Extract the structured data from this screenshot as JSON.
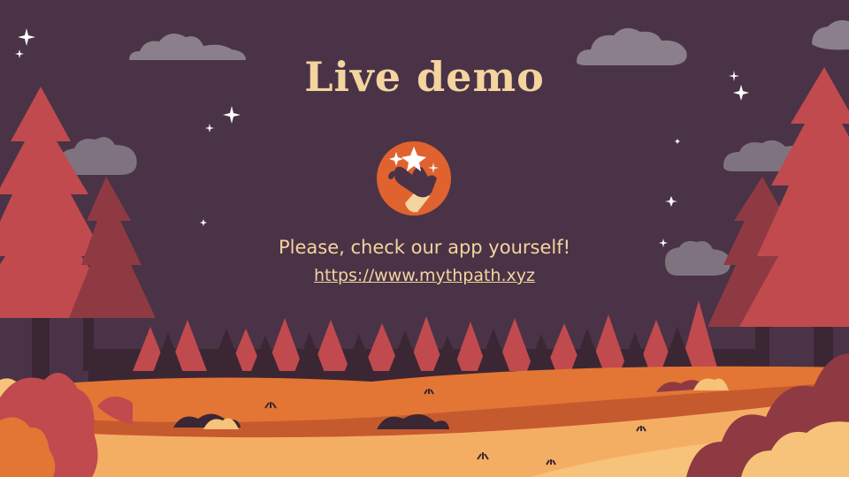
{
  "slide": {
    "title": "Live demo",
    "subtitle": "Please, check our app yourself!",
    "link_text": "https://www.mythpath.xyz"
  },
  "logo": {
    "icon": "magic-hand-icon",
    "colors": {
      "circle": "#e0622f",
      "hand": "#4a3346",
      "sparkle": "#ffffff"
    }
  },
  "colors": {
    "background": "#4a3346",
    "text": "#f4d49f",
    "tree_red": "#c04a4e",
    "tree_dark": "#3b2634",
    "ground_orange": "#e37634",
    "ground_light": "#f4ae63",
    "cloud": "#8a7f8b"
  }
}
